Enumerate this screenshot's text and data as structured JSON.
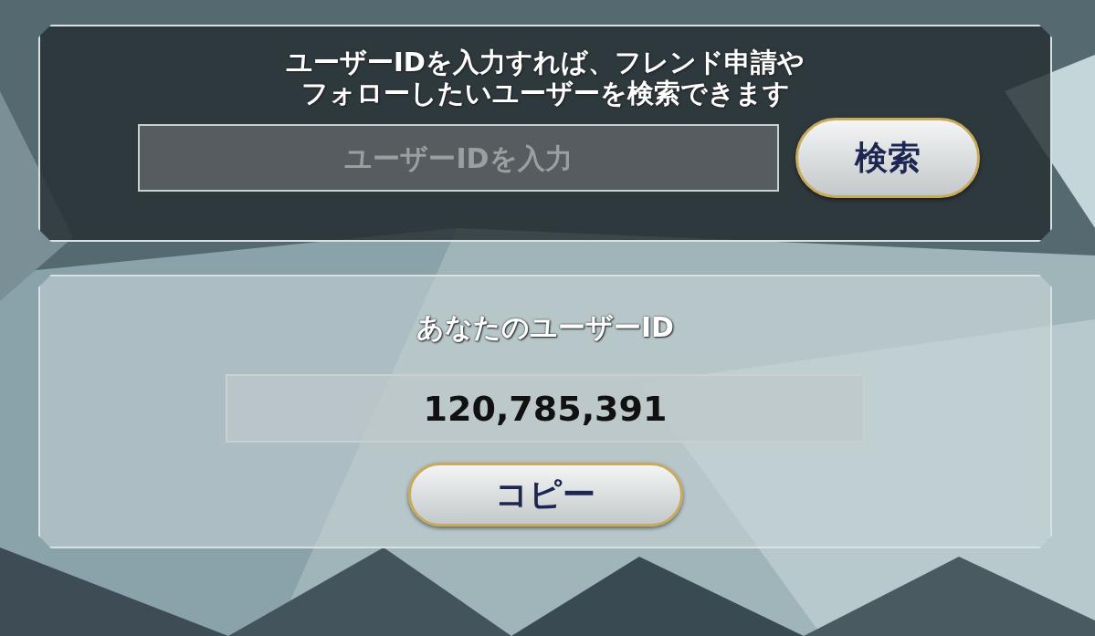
{
  "search_panel": {
    "kind": "dark",
    "message_lines": [
      "ユーザーIDを入力すれば、フレンド申請や",
      "フォローしたいユーザーを検索できます"
    ],
    "id_field": {
      "placeholder": "ユーザーIDを入力"
    },
    "search_button": "検索"
  },
  "my_id_panel": {
    "kind": "light",
    "title": "あなたのユーザーID",
    "id_field": {
      "value": "120,785,391"
    },
    "copy_button": "コピー"
  }
}
